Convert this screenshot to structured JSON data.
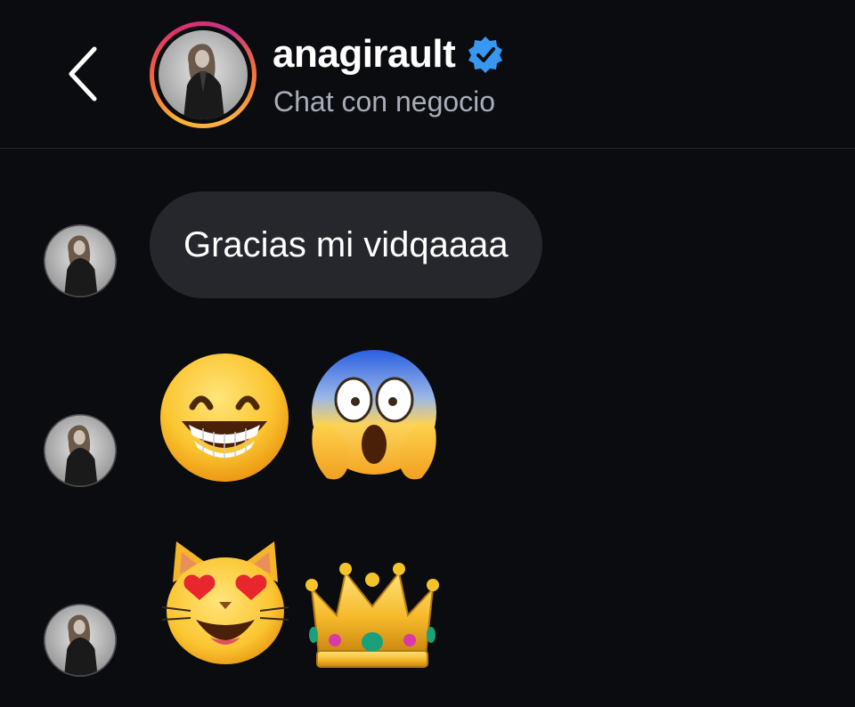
{
  "header": {
    "back_icon": "chevron-left-icon",
    "username": "anagirault",
    "verified_icon": "verified-badge-icon",
    "subtitle": "Chat con negocio",
    "colors": {
      "verified": "#3897f0",
      "story_ring": [
        "#f9b233",
        "#f56040",
        "#e1306c",
        "#c13584"
      ]
    }
  },
  "messages": [
    {
      "type": "text",
      "text": "Gracias mi vidqaaaa"
    },
    {
      "type": "emoji",
      "items": [
        "grinning-face-with-smiling-eyes",
        "face-screaming-in-fear"
      ]
    },
    {
      "type": "emoji",
      "items": [
        "smiling-cat-with-heart-eyes",
        "crown"
      ]
    }
  ],
  "colors": {
    "background": "#0b0c10",
    "bubble": "#25272c",
    "subtitle": "#a8adb8"
  }
}
